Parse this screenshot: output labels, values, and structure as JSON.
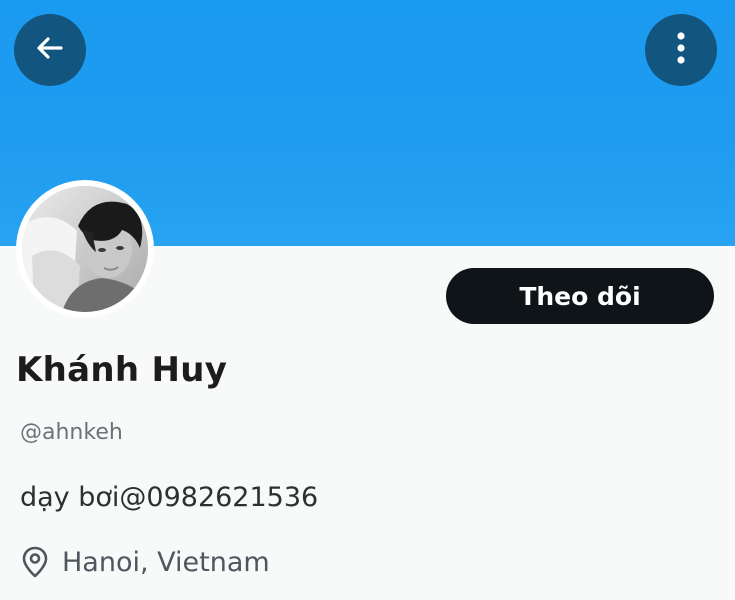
{
  "header": {
    "back_icon": "arrow-left-icon",
    "more_icon": "more-vertical-icon",
    "banner_color": "#1d9bf0",
    "button_color": "#12557f"
  },
  "profile": {
    "display_name": "Khánh Huy",
    "handle": "@ahnkeh",
    "bio": "dạy bơi@0982621536",
    "location": "Hanoi, Vietnam",
    "location_icon": "location-pin-icon",
    "avatar": "profile-photo"
  },
  "actions": {
    "follow_label": "Theo dõi",
    "follow_color": "#0f1419"
  }
}
